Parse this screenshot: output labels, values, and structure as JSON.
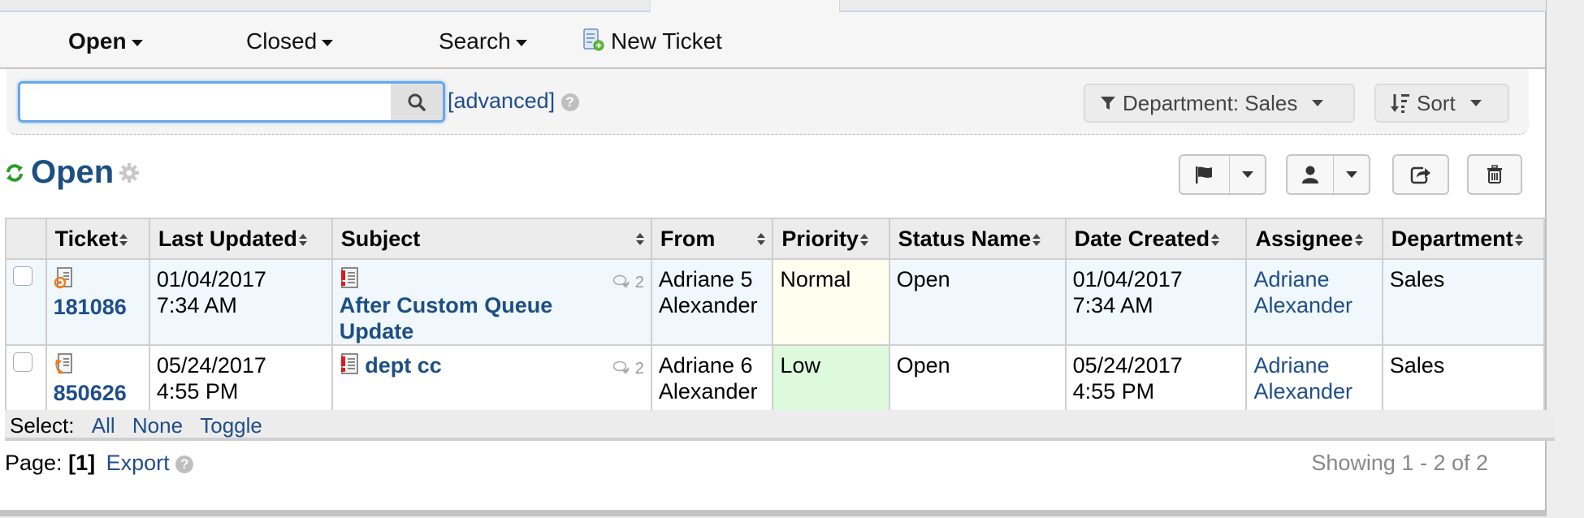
{
  "nav": {
    "items": [
      {
        "label": "Open",
        "has_caret": true,
        "active": true
      },
      {
        "label": "Closed",
        "has_caret": true,
        "active": false
      },
      {
        "label": "Search",
        "has_caret": true,
        "active": false
      }
    ],
    "new_ticket_label": "New Ticket"
  },
  "search": {
    "value": "",
    "placeholder": "",
    "advanced_label": "[advanced]",
    "help_glyph": "?"
  },
  "filters": {
    "department_label": "Department: Sales",
    "sort_label": "Sort"
  },
  "queue": {
    "title": "Open",
    "actions": [
      "flag-icon",
      "assign-user-icon",
      "transfer-icon",
      "trash-icon"
    ]
  },
  "table": {
    "columns": [
      "Ticket",
      "Last Updated",
      "Subject",
      "From",
      "Priority",
      "Status Name",
      "Date Created",
      "Assignee",
      "Department"
    ],
    "rows": [
      {
        "ticket_number": "181086",
        "source_icon": "email-icon",
        "last_updated_date": "01/04/2017",
        "last_updated_time": "7:34 AM",
        "subject": "After Custom Queue Update",
        "thread_count": "2",
        "from_first": "Adriane 5",
        "from_last": "Alexander",
        "priority": "Normal",
        "priority_color": "#fffff0",
        "status": "Open",
        "created_date": "01/04/2017",
        "created_time": "7:34 AM",
        "assignee_first": "Adriane",
        "assignee_last": "Alexander",
        "department": "Sales"
      },
      {
        "ticket_number": "850626",
        "source_icon": "phone-icon",
        "last_updated_date": "05/24/2017",
        "last_updated_time": "4:55 PM",
        "subject": "dept cc",
        "thread_count": "2",
        "from_first": "Adriane 6",
        "from_last": "Alexander",
        "priority": "Low",
        "priority_color": "#ddfadd",
        "status": "Open",
        "created_date": "05/24/2017",
        "created_time": "4:55 PM",
        "assignee_first": "Adriane",
        "assignee_last": "Alexander",
        "department": "Sales"
      }
    ]
  },
  "select_bar": {
    "label": "Select:",
    "all": "All",
    "none": "None",
    "toggle": "Toggle"
  },
  "footer": {
    "page_label": "Page:",
    "current_page": "[1]",
    "export_label": "Export",
    "help_glyph": "?",
    "showing": "Showing 1 - 2 of 2"
  },
  "colors": {
    "link": "#1f4e8a",
    "refresh_green": "#2a9d2a",
    "row_highlight": "#f0f7fd"
  }
}
